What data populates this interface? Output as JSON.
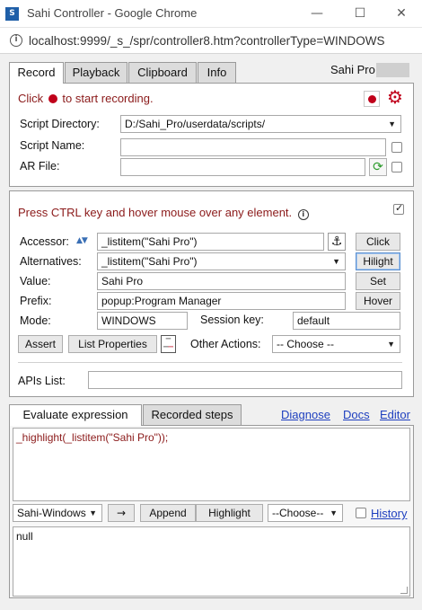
{
  "window": {
    "title": "Sahi Controller - Google Chrome",
    "url": "localhost:9999/_s_/spr/controller8.htm?controllerType=WINDOWS"
  },
  "tabs": [
    "Record",
    "Playback",
    "Clipboard",
    "Info"
  ],
  "user": "Sahi Pro",
  "record": {
    "instruction_prefix": "Click",
    "instruction_suffix": "to start recording.",
    "script_directory_label": "Script Directory:",
    "script_directory_value": "D:/Sahi_Pro/userdata/scripts/",
    "script_name_label": "Script Name:",
    "script_name_value": "",
    "ar_file_label": "AR File:",
    "ar_file_value": ""
  },
  "inspector": {
    "instruction": "Press CTRL key and hover mouse over any element.",
    "accessor_label": "Accessor:",
    "accessor_value": "_listitem(\"Sahi Pro\")",
    "alternatives_label": "Alternatives:",
    "alternatives_value": "_listitem(\"Sahi Pro\")",
    "value_label": "Value:",
    "value_value": "Sahi Pro",
    "prefix_label": "Prefix:",
    "prefix_value": "popup:Program Manager",
    "mode_label": "Mode:",
    "mode_value": "WINDOWS",
    "session_key_label": "Session key:",
    "session_key_value": "default",
    "buttons": {
      "click": "Click",
      "hilight": "Hilight",
      "set": "Set",
      "hover": "Hover",
      "assert": "Assert",
      "list_properties": "List Properties"
    },
    "other_actions_label": "Other Actions:",
    "other_actions_value": "-- Choose --",
    "apis_label": "APIs List:",
    "apis_value": ""
  },
  "evaluate": {
    "tabs": [
      "Evaluate expression",
      "Recorded steps"
    ],
    "links": [
      "Diagnose",
      "Docs",
      "Editor"
    ],
    "expression": "_highlight(_listitem(\"Sahi Pro\"));",
    "mode_select": "Sahi-Windows",
    "arrow_button": "→",
    "append_button": "Append",
    "highlight_button": "Highlight",
    "choose_select": "--Choose--",
    "history_link": "History",
    "output": "null"
  },
  "colors": {
    "record_red": "#c0001a",
    "instruction_text": "#8b1a1a",
    "link_blue": "#1e3fbf"
  }
}
